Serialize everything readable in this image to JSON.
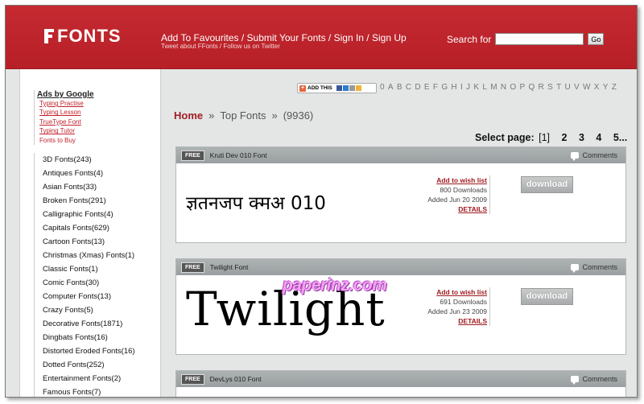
{
  "header": {
    "logo": "FONTS",
    "nav": [
      "Add To Favourites",
      "Submit Your Fonts",
      "Sign In",
      "Sign Up"
    ],
    "subnav": [
      "Tweet about FFonts",
      "Follow us on Twitter"
    ],
    "search_label": "Search for",
    "search_value": "",
    "go_label": "Go"
  },
  "ads": {
    "title": "Ads by Google",
    "links": [
      "Typing Practise",
      "Typing Lesson",
      "TrueType Font",
      "Typing Tutor",
      "Fonts to Buy"
    ]
  },
  "categories": [
    "3D Fonts(243)",
    "Antiques Fonts(4)",
    "Asian Fonts(33)",
    "Broken Fonts(291)",
    "Calligraphic Fonts(4)",
    "Capitals Fonts(629)",
    "Cartoon Fonts(13)",
    "Christmas (Xmas) Fonts(1)",
    "Classic Fonts(1)",
    "Comic Fonts(30)",
    "Computer Fonts(13)",
    "Crazy Fonts(5)",
    "Decorative Fonts(1871)",
    "Dingbats Fonts(16)",
    "Distorted Eroded Fonts(16)",
    "Dotted Fonts(252)",
    "Entertainment Fonts(2)",
    "Famous Fonts(7)"
  ],
  "bookmark_label": "ADD THIS",
  "alphabet": [
    "0",
    "A",
    "B",
    "C",
    "D",
    "E",
    "F",
    "G",
    "H",
    "I",
    "J",
    "K",
    "L",
    "M",
    "N",
    "O",
    "P",
    "Q",
    "R",
    "S",
    "T",
    "U",
    "V",
    "W",
    "X",
    "Y",
    "Z"
  ],
  "breadcrumb": {
    "home": "Home",
    "sep": "»",
    "section": "Top Fonts",
    "count": "(9936)"
  },
  "pager": {
    "label": "Select page:",
    "current": "[1]",
    "pages": [
      "2",
      "3",
      "4",
      "5..."
    ]
  },
  "fonts": [
    {
      "badge": "FREE",
      "name": "Kruti Dev 010 Font",
      "comments": "Comments",
      "preview": "ज्ञतनजप क्मअ 010",
      "wish": "Add to wish list",
      "downloads": "800 Downloads",
      "added": "Added Jun 20 2009",
      "details": "DETAILS",
      "download": "download"
    },
    {
      "badge": "FREE",
      "name": "Twilight Font",
      "comments": "Comments",
      "preview": "Twilight",
      "wish": "Add to wish list",
      "downloads": "691 Downloads",
      "added": "Added Jun 23 2009",
      "details": "DETAILS",
      "download": "download"
    },
    {
      "badge": "FREE",
      "name": "DevLys 010 Font",
      "comments": "Comments"
    }
  ],
  "watermark": "paperinz.com"
}
